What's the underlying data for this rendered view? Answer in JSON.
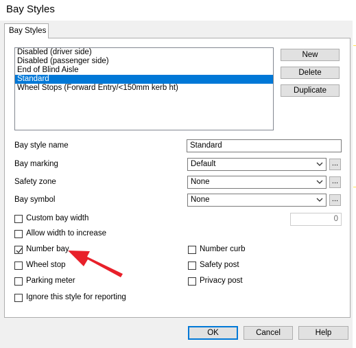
{
  "window": {
    "title": "Bay Styles"
  },
  "tabs": [
    {
      "label": "Bay Styles"
    }
  ],
  "style_list": {
    "items": [
      "Disabled (driver side)",
      "Disabled (passenger side)",
      "End of Blind Aisle",
      "Standard",
      "Wheel Stops (Forward Entry/<150mm kerb ht)"
    ],
    "selected": "Standard"
  },
  "side_buttons": {
    "new": "New",
    "delete": "Delete",
    "duplicate": "Duplicate"
  },
  "form": {
    "bay_style_name": {
      "label": "Bay style name",
      "value": "Standard"
    },
    "bay_marking": {
      "label": "Bay marking",
      "value": "Default",
      "more": "..."
    },
    "safety_zone": {
      "label": "Safety zone",
      "value": "None",
      "more": "..."
    },
    "bay_symbol": {
      "label": "Bay symbol",
      "value": "None",
      "more": "..."
    },
    "custom_width_value": "0"
  },
  "checkboxes": {
    "custom_bay_width": {
      "label": "Custom bay width",
      "checked": false
    },
    "allow_width_increase": {
      "label": "Allow width to increase",
      "checked": false
    },
    "number_bay": {
      "label": "Number bay",
      "checked": true
    },
    "number_curb": {
      "label": "Number curb",
      "checked": false
    },
    "wheel_stop": {
      "label": "Wheel stop",
      "checked": false
    },
    "safety_post": {
      "label": "Safety post",
      "checked": false
    },
    "parking_meter": {
      "label": "Parking meter",
      "checked": false
    },
    "privacy_post": {
      "label": "Privacy post",
      "checked": false
    },
    "ignore_reporting": {
      "label": "Ignore this style for reporting",
      "checked": false
    }
  },
  "footer": {
    "ok": "OK",
    "cancel": "Cancel",
    "help": "Help"
  },
  "colors": {
    "selection": "#0078d7",
    "annotation_arrow": "#e8202a"
  }
}
